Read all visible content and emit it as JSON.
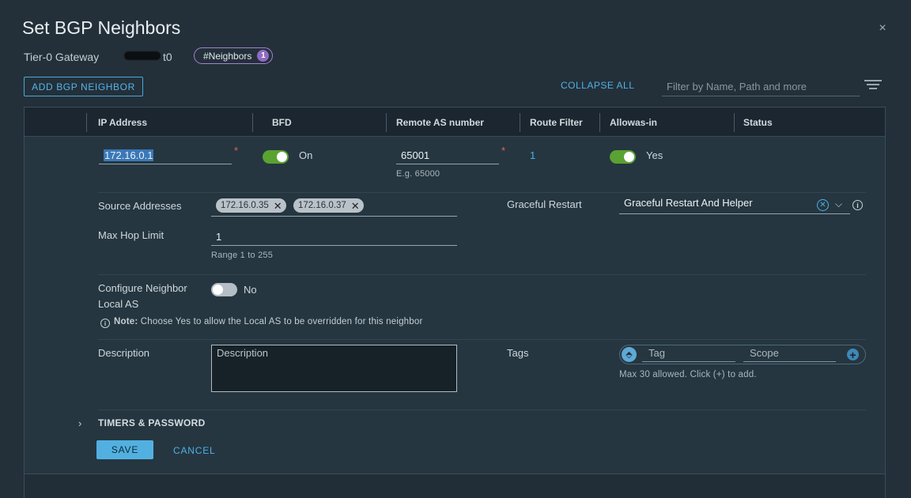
{
  "dialog": {
    "title": "Set BGP Neighbors",
    "close_symbol": "×",
    "gateway_label": "Tier-0 Gateway",
    "gateway_name_visible": "t0",
    "neighbors_pill_label": "#Neighbors",
    "neighbors_count": "1"
  },
  "toolbar": {
    "add_button": "ADD BGP NEIGHBOR",
    "collapse_all": "COLLAPSE ALL",
    "filter_placeholder": "Filter by Name, Path and more",
    "filter_icon": "filter-lines-icon"
  },
  "grid": {
    "columns": [
      "IP Address",
      "BFD",
      "Remote AS number",
      "Route Filter",
      "Allowas-in",
      "Status"
    ]
  },
  "row": {
    "ip_address": "172.16.0.1",
    "required_mark": "*",
    "bfd_state": "On",
    "remote_as": "65001",
    "remote_as_hint": "E.g. 65000",
    "route_filter_count": "1",
    "allowas_state": "Yes"
  },
  "details": {
    "source_addresses_label": "Source Addresses",
    "source_addresses": [
      "172.16.0.35",
      "172.16.0.37"
    ],
    "chip_remove_symbol": "✕",
    "graceful_restart_label": "Graceful Restart",
    "graceful_restart_value": "Graceful Restart And Helper",
    "max_hop_label": "Max Hop Limit",
    "max_hop_value": "1",
    "max_hop_hint": "Range 1 to 255",
    "local_as_label_line1": "Configure Neighbor",
    "local_as_label_line2": "Local AS",
    "local_as_state": "No",
    "note_bold": "Note:",
    "note_text": " Choose Yes to allow the Local AS to be overridden for this neighbor",
    "description_label": "Description",
    "description_placeholder": "Description",
    "tags_label": "Tags",
    "tag_placeholder": "Tag",
    "scope_placeholder": "Scope",
    "tags_hint": "Max 30 allowed. Click (+) to add.",
    "timers_label": "TIMERS & PASSWORD"
  },
  "actions": {
    "save": "SAVE",
    "cancel": "CANCEL"
  },
  "colors": {
    "background": "#233039",
    "accent_blue": "#4fb0e6",
    "toggle_on": "#5aa232",
    "required": "#e06848",
    "pill_border": "#a77fd4"
  }
}
